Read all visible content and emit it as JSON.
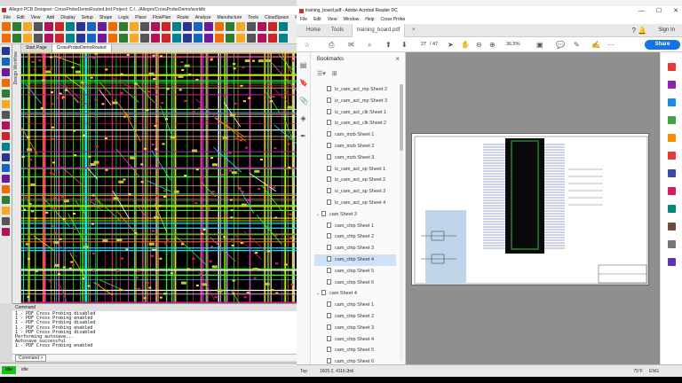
{
  "left_app": {
    "title": "Allegro PCB Designer: CrossProbeDemoRouted.brd  Project: C:/.../Allegro/CrossProbeDemo/worklib",
    "menu": [
      "File",
      "Edit",
      "View",
      "Add",
      "Display",
      "Setup",
      "Shape",
      "Logic",
      "Place",
      "FlowPlan",
      "Route",
      "Analyze",
      "Manufacture",
      "Tools",
      "CloudSpace",
      "RDM",
      "Help"
    ],
    "side_panel_label": "Design Workflow",
    "tabs": [
      "Start Page",
      "CrossProbeDemoRouted"
    ],
    "command_header": "Command",
    "command_log": [
      "1 - PDF Cross Probing disabled",
      "1 - PDF Cross Probing enabled",
      "1 - PDF Cross Probing disabled",
      "1 - PDF Cross Probing enabled",
      "1 - PDF Cross Probing disabled",
      "Performing autosave...",
      "Autosave successful",
      "1 - PDF Cross Probing enabled"
    ],
    "command_input_label": "Command >",
    "status": {
      "state": "Idle",
      "command": "idle"
    }
  },
  "right_app": {
    "title": "training_board.pdf - Adobe Acrobat Reader DC",
    "window_controls": [
      "—",
      "☐",
      "✕"
    ],
    "menu": [
      "File",
      "Edit",
      "View",
      "Window",
      "Help",
      "Cross Probe"
    ],
    "tabs": {
      "home": "Home",
      "tools": "Tools",
      "document": "training_board.pdf"
    },
    "sign_in": "Sign In",
    "toolbar": {
      "page_current": "27",
      "page_total": "/ 47",
      "zoom": "36.5%",
      "share_label": "Share"
    },
    "bookmarks": {
      "heading": "Bookmarks",
      "items": [
        {
          "label": "iz_cam_act_mp Sheet 2",
          "level": 2,
          "expanded": null,
          "selected": false
        },
        {
          "label": "iz_cam_act_mp Sheet 3",
          "level": 2,
          "expanded": null,
          "selected": false
        },
        {
          "label": "iz_cam_act_clk Sheet 1",
          "level": 2,
          "expanded": null,
          "selected": false
        },
        {
          "label": "iz_cam_act_clk Sheet 2",
          "level": 2,
          "expanded": null,
          "selected": false
        },
        {
          "label": "cam_mzb Sheet 1",
          "level": 2,
          "expanded": null,
          "selected": false
        },
        {
          "label": "cam_mzb Sheet 2",
          "level": 2,
          "expanded": null,
          "selected": false
        },
        {
          "label": "cam_mzb Sheet 3",
          "level": 2,
          "expanded": null,
          "selected": false
        },
        {
          "label": "iz_cam_act_sp Sheet 1",
          "level": 2,
          "expanded": null,
          "selected": false
        },
        {
          "label": "iz_cam_act_sp Sheet 2",
          "level": 2,
          "expanded": null,
          "selected": false
        },
        {
          "label": "iz_cam_act_sp Sheet 3",
          "level": 2,
          "expanded": null,
          "selected": false
        },
        {
          "label": "iz_cam_act_sp Sheet 4",
          "level": 2,
          "expanded": null,
          "selected": false
        },
        {
          "label": "cam Sheet 3",
          "level": 1,
          "expanded": true,
          "selected": false
        },
        {
          "label": "cam_chip Sheet 1",
          "level": 2,
          "expanded": null,
          "selected": false
        },
        {
          "label": "cam_chip Sheet 2",
          "level": 2,
          "expanded": null,
          "selected": false
        },
        {
          "label": "cam_chip Sheet 3",
          "level": 2,
          "expanded": null,
          "selected": false
        },
        {
          "label": "cam_chip Sheet 4",
          "level": 2,
          "expanded": null,
          "selected": true
        },
        {
          "label": "cam_chip Sheet 5",
          "level": 2,
          "expanded": null,
          "selected": false
        },
        {
          "label": "cam_chip Sheet 6",
          "level": 2,
          "expanded": null,
          "selected": false
        },
        {
          "label": "cam Sheet 4",
          "level": 1,
          "expanded": true,
          "selected": false
        },
        {
          "label": "cam_chip Sheet 1",
          "level": 2,
          "expanded": null,
          "selected": false
        },
        {
          "label": "cam_chip Sheet 2",
          "level": 2,
          "expanded": null,
          "selected": false
        },
        {
          "label": "cam_chip Sheet 3",
          "level": 2,
          "expanded": null,
          "selected": false
        },
        {
          "label": "cam_chip Sheet 4",
          "level": 2,
          "expanded": null,
          "selected": false
        },
        {
          "label": "cam_chip Sheet 5",
          "level": 2,
          "expanded": null,
          "selected": false
        },
        {
          "label": "cam_chip Sheet 6",
          "level": 2,
          "expanded": null,
          "selected": false
        }
      ]
    },
    "status_bar": {
      "layer": "Top",
      "coords": "1605.2, 4116.2",
      "unit": "mil"
    }
  },
  "taskbar_tray": {
    "weather": "75°F",
    "lang": "ENG"
  }
}
